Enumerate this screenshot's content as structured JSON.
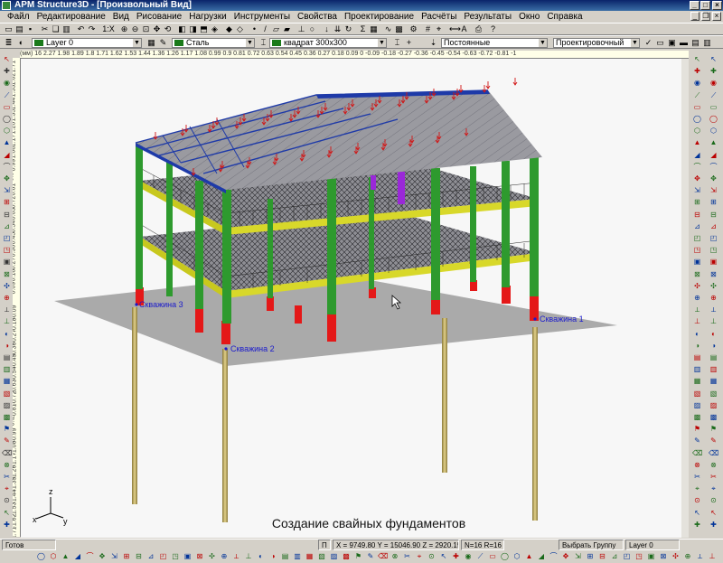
{
  "window": {
    "title": "APM Structure3D - [Произвольный Вид]"
  },
  "menu": [
    "Файл",
    "Редактирование",
    "Вид",
    "Рисование",
    "Нагрузки",
    "Инструменты",
    "Свойства",
    "Проектирование",
    "Расчёты",
    "Результаты",
    "Окно",
    "Справка"
  ],
  "toolbar1": {
    "scale_label": "1:X"
  },
  "toolbar2": {
    "layer": "Layer 0",
    "material": "Сталь",
    "section": "квадрат 300x300",
    "load_type": "Постоянные",
    "mode": "Проектировочный"
  },
  "ruler": {
    "unit": "(мм)",
    "ticks": "16  2.27  1.98  1.89  1.8  1.71  1.62  1.53  1.44  1.36  1.26  1.17  1.08  0.99  0.9  0.81  0.72  0.63  0.54  0.45  0.36  0.27  0.18  0.09  0  -0.09  -0.18  -0.27  -0.36  -0.45  -0.54  -0.63  -0.72  -0.81  -1"
  },
  "vruler_ticks": [
    "1.71",
    "1.62",
    "1.53",
    "1.44",
    "1.35",
    "1.26",
    "1.17",
    "1.08",
    "0.99",
    "0.9",
    "0.81",
    "0.72",
    "0.63",
    "0.54",
    "0.45",
    "0.36",
    "0.27",
    "0.18",
    "0.09",
    "0",
    "-0.09",
    "-0.18",
    "-0.27",
    "-0.36",
    "-0.45",
    "-0.54",
    "-0.63",
    "-0.72",
    "-0.81",
    "-0.9",
    "-0.99",
    "-1.08",
    "-1.17",
    "-1.26",
    "-1.35",
    "-1.44",
    "-1.53",
    "-1.62",
    "-1.71"
  ],
  "model": {
    "boreholes": [
      "Скважина 1",
      "Скважина 2",
      "Скважина 3"
    ],
    "axis": {
      "z": "z",
      "x": "x",
      "y": "y"
    },
    "colors": {
      "column": "#2e9a2e",
      "base": "#e41818",
      "beam": "#c8c81e",
      "roof": "#9a9aa0",
      "pile": "#c8b46a",
      "ground": "#a8a8a8",
      "brace": "#9a28d8",
      "rafter": "#1e3aa8",
      "load_arrow": "#d21414"
    }
  },
  "caption": "Создание свайных фундаментов",
  "status": {
    "ready": "Готов",
    "mode_flag": "П",
    "coords": "X = 9749.80 Y = 15046.90 Z = 2920.15",
    "counts": "N=16 R=16",
    "selection": "Выбрать Группу",
    "layer": "Layer 0"
  }
}
